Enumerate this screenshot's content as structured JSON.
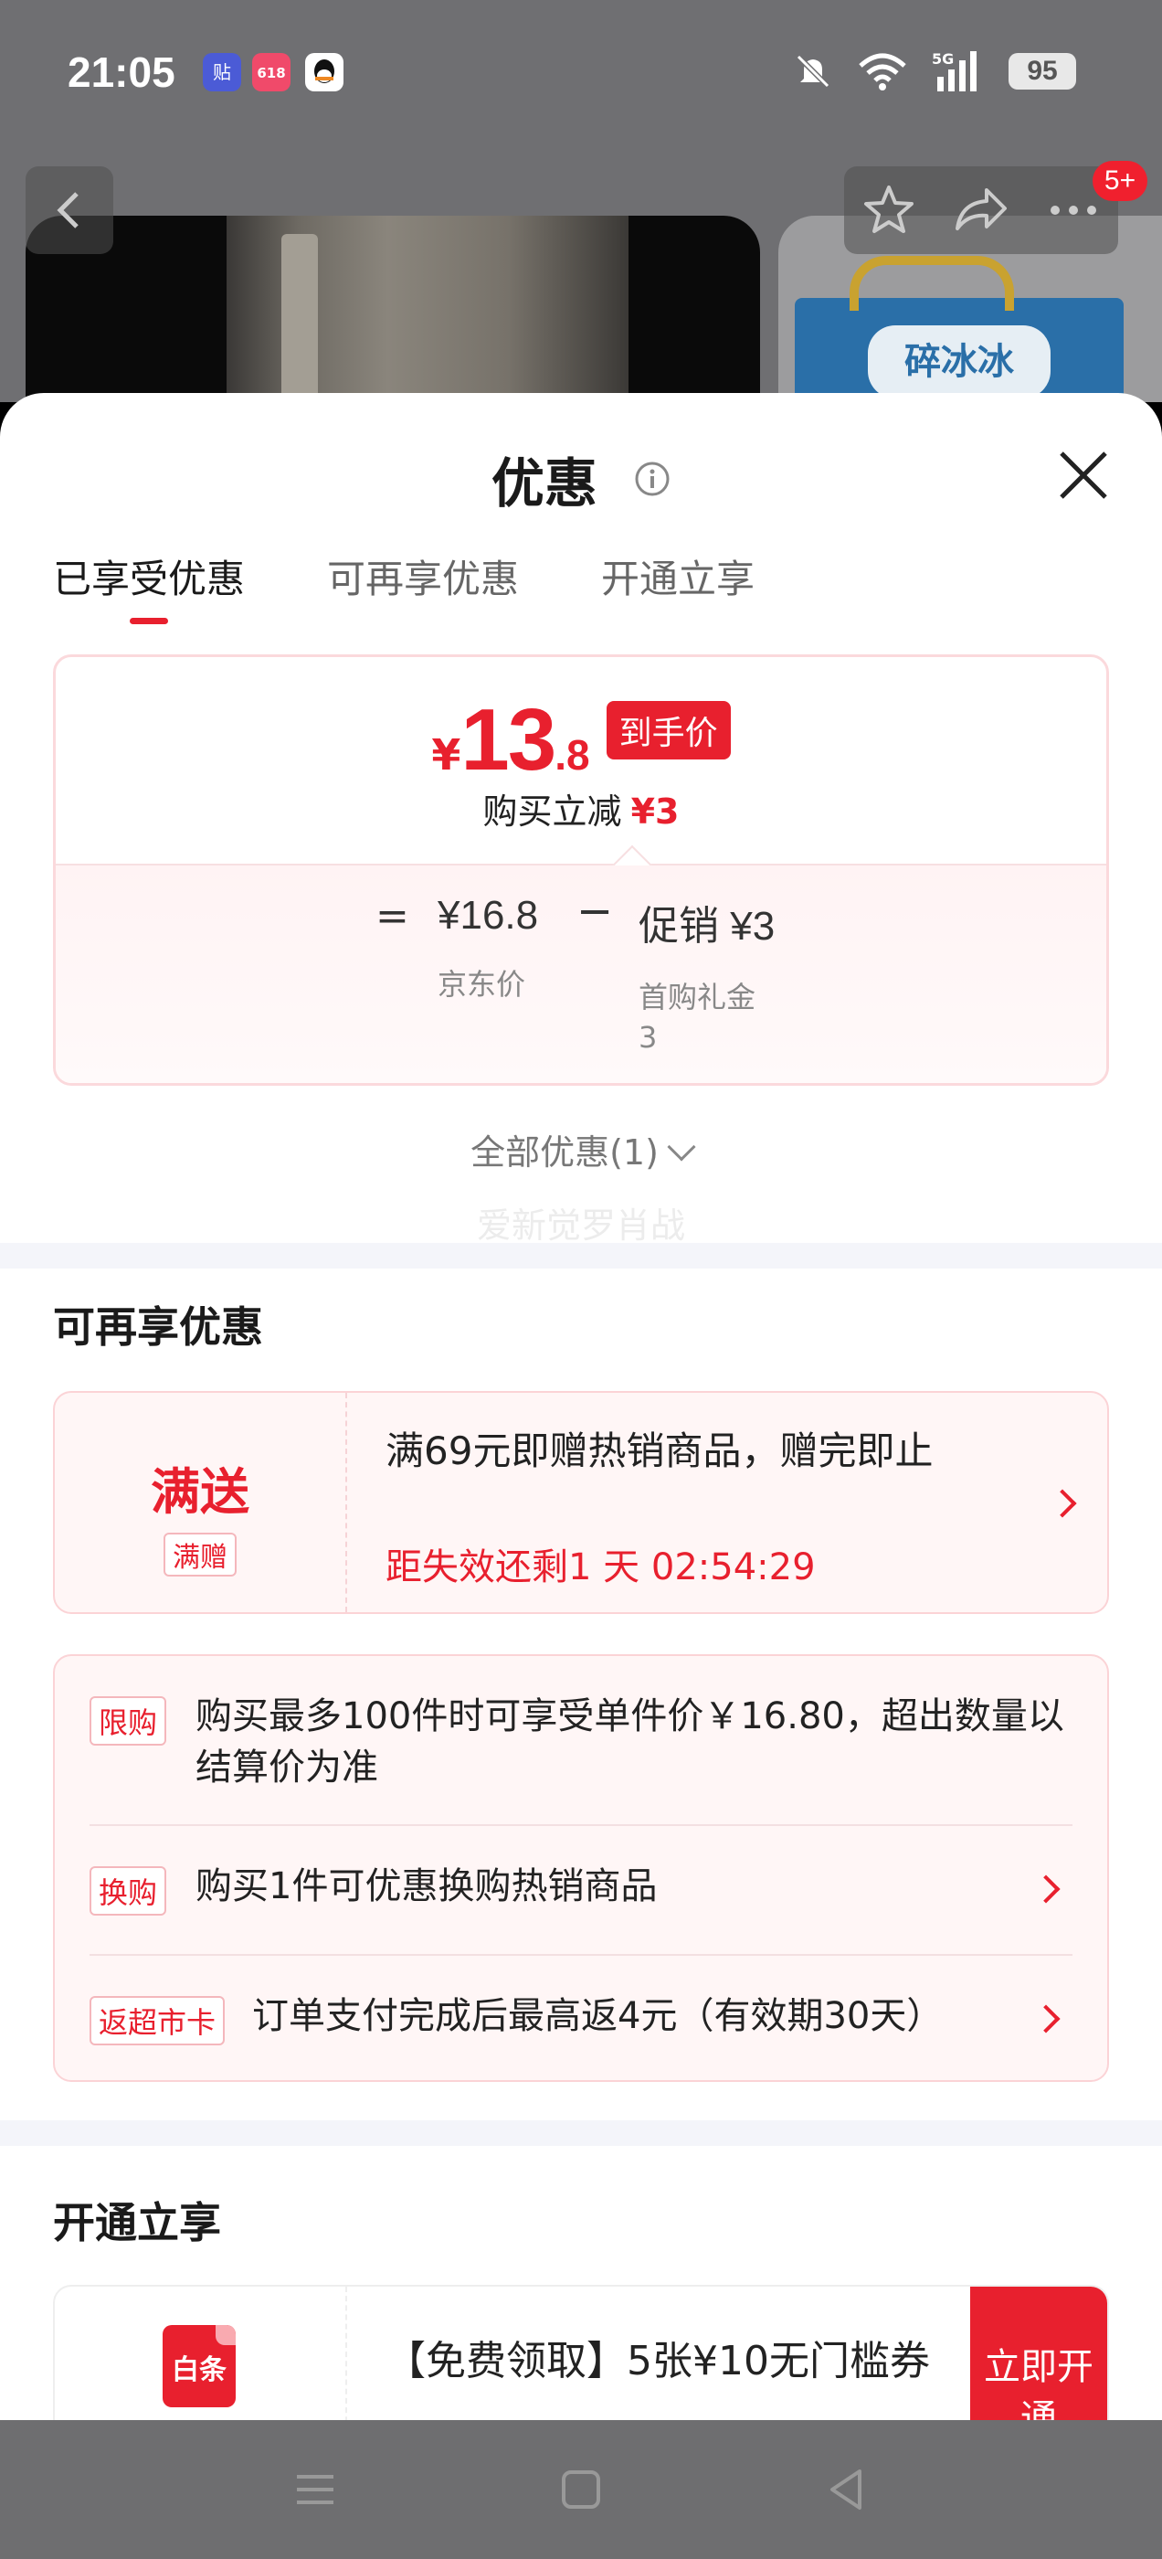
{
  "status_bar": {
    "time": "21:05",
    "battery": "95",
    "network": "5G",
    "icons": [
      "tieba-app-icon",
      "618-app-icon",
      "qq-app-icon",
      "mute-icon",
      "wifi-icon",
      "signal-icon",
      "battery-icon"
    ]
  },
  "top_nav": {
    "notification_badge": "5+",
    "icons": [
      "back-icon",
      "star-icon",
      "share-icon",
      "more-icon"
    ]
  },
  "background": {
    "product_label": "碎冰冰"
  },
  "sheet": {
    "title": "优惠",
    "tabs": [
      {
        "label": "已享受优惠",
        "active": true
      },
      {
        "label": "可再享优惠",
        "active": false
      },
      {
        "label": "开通立享",
        "active": false
      }
    ],
    "price_card": {
      "currency": "¥",
      "price_int": "13",
      "price_dec": ".8",
      "badge": "到手价",
      "discount_label": "购买立减",
      "discount_value": "¥3",
      "equals": "=",
      "jd_price_value": "¥16.8",
      "jd_price_label": "京东价",
      "minus": "−",
      "promo_value": "促销 ¥3",
      "promo_label": "首购礼金",
      "promo_sub": "3"
    },
    "all_offers": "全部优惠(1)",
    "watermark": "爱新觉罗肖战",
    "section_more": "可再享优惠",
    "gift": {
      "title": "满送",
      "tag": "满赠",
      "text": "满69元即赠热销商品，赠完即止",
      "countdown": "距失效还剩1 天 02:54:29"
    },
    "rules": [
      {
        "tag": "限购",
        "text": "购买最多100件时可享受单件价￥16.80，超出数量以结算价为准"
      },
      {
        "tag": "换购",
        "text": "购买1件可优惠换购热销商品"
      },
      {
        "tag": "返超市卡",
        "text": "订单支付完成后最高返4元（有效期30天）"
      }
    ],
    "section_open": "开通立享",
    "open": {
      "logo": "白条",
      "text": "【免费领取】5张¥10无门槛券",
      "button": "立即开通"
    }
  },
  "colors": {
    "accent": "#e8202e",
    "card_bg": "#fff6f6",
    "card_border": "#fbd3d6",
    "divider": "#f4f5fa"
  }
}
